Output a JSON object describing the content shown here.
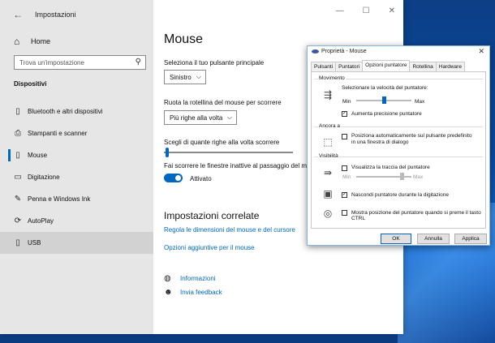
{
  "settings": {
    "title": "Impostazioni",
    "back_glyph": "←",
    "window_controls": [
      "—",
      "☐",
      "✕"
    ],
    "home": {
      "label": "Home",
      "icon": "home-icon"
    },
    "search": {
      "placeholder": "Trova un'impostazione",
      "icon": "search-icon"
    },
    "section": "Dispositivi",
    "nav": [
      {
        "label": "Bluetooth e altri dispositivi",
        "icon": "bluetooth-devices-icon",
        "glyph": "▯"
      },
      {
        "label": "Stampanti e scanner",
        "icon": "printer-icon",
        "glyph": "⎙"
      },
      {
        "label": "Mouse",
        "icon": "mouse-icon",
        "glyph": "▯"
      },
      {
        "label": "Digitazione",
        "icon": "keyboard-icon",
        "glyph": "▭"
      },
      {
        "label": "Penna e Windows Ink",
        "icon": "pen-icon",
        "glyph": "✎"
      },
      {
        "label": "AutoPlay",
        "icon": "autoplay-icon",
        "glyph": "⟳"
      },
      {
        "label": "USB",
        "icon": "usb-icon",
        "glyph": "▯"
      }
    ],
    "main": {
      "title": "Mouse",
      "primary_button_label": "Seleziona il tuo pulsante principale",
      "primary_button_value": "Sinistro",
      "wheel_label": "Ruota la rotellina del mouse per scorrere",
      "wheel_value": "Più righe alla volta",
      "lines_label": "Scegli di quante righe alla volta scorrere",
      "lines_value_fraction": 0.02,
      "inactive_label": "Fai scorrere le finestre inattive al passaggio del mo",
      "toggle_label": "Attivato",
      "related_title": "Impostazioni correlate",
      "link1": "Regola le dimensioni del mouse e del cursore",
      "link2": "Opzioni aggiuntive per il mouse",
      "info_label": "Informazioni",
      "feedback_label": "Invia feedback"
    }
  },
  "dialog": {
    "title": "Proprietà - Mouse",
    "close": "✕",
    "tabs": [
      "Pulsanti",
      "Puntatori",
      "Opzioni puntatore",
      "Rotellina",
      "Hardware"
    ],
    "active_tab": "Opzioni puntatore",
    "movimento": {
      "title": "Movimento",
      "speed_label": "Selezionare la velocità del puntatore:",
      "min": "Min",
      "max": "Max",
      "speed_fraction": 0.5,
      "precision_label": "Aumenta precisione puntatore",
      "precision_checked": "✓"
    },
    "ancora": {
      "title": "Ancora a",
      "snap_label_1": "Posiziona automaticamente sul pulsante predefinito",
      "snap_label_2": "in una finestra di dialogo"
    },
    "visibilita": {
      "title": "Visibilità",
      "trails_label": "Visualizza la traccia del puntatore",
      "min": "Min",
      "max": "Max",
      "hide_label": "Nascondi puntatore durante la digitazione",
      "hide_checked": "✓",
      "ctrl_label": "Mostra posizione del puntatore quando si preme il tasto CTRL"
    },
    "buttons": {
      "ok": "OK",
      "cancel": "Annulla",
      "apply": "Applica"
    }
  }
}
